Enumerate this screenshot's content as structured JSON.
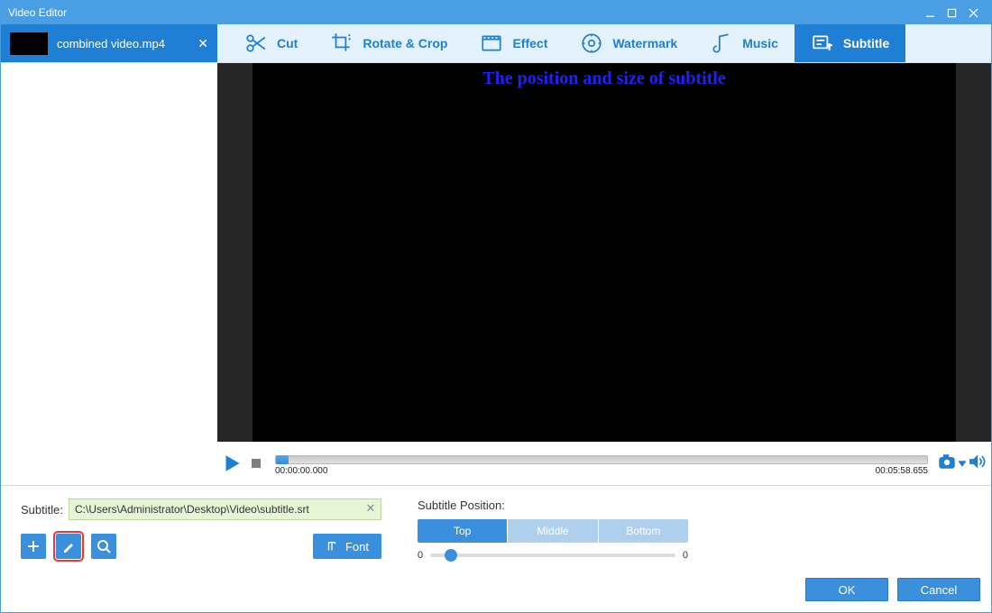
{
  "window_title": "Video Editor",
  "file_tab": {
    "name": "combined video.mp4"
  },
  "tools": {
    "cut": "Cut",
    "rotate": "Rotate & Crop",
    "effect": "Effect",
    "watermark": "Watermark",
    "music": "Music",
    "subtitle": "Subtitle",
    "active": "subtitle"
  },
  "subtitle_preview_text": "The position and size of subtitle",
  "player": {
    "current_time": "00:00:00.000",
    "total_time": "00:05:58.655"
  },
  "subtitle_panel": {
    "label": "Subtitle:",
    "path": "C:\\Users\\Administrator\\Desktop\\Video\\subtitle.srt",
    "font_button": "Font"
  },
  "position_panel": {
    "label": "Subtitle Position:",
    "options": {
      "top": "Top",
      "middle": "Middle",
      "bottom": "Bottom"
    },
    "active": "top",
    "slider_min": "0",
    "slider_max": "0"
  },
  "dialog": {
    "ok": "OK",
    "cancel": "Cancel"
  }
}
